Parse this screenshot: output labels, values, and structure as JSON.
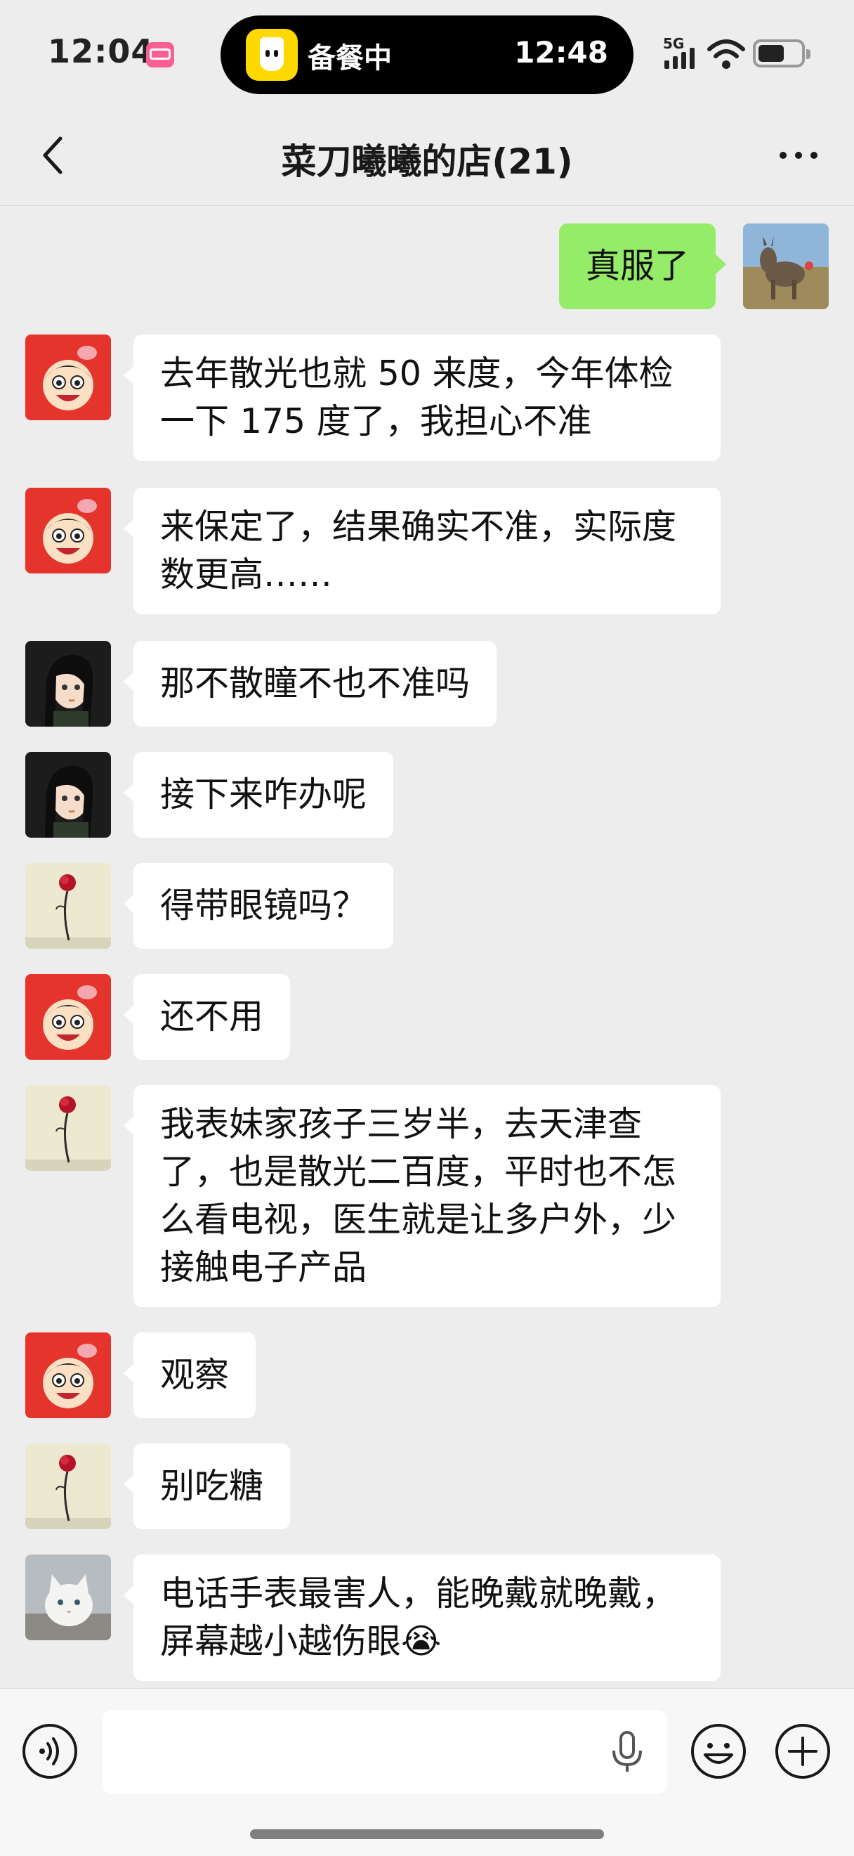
{
  "status_bar": {
    "time": "12:04",
    "network": "5G",
    "island_app": "备餐中",
    "island_timer": "12:48"
  },
  "nav": {
    "title": "菜刀曦曦的店(21)"
  },
  "messages": [
    {
      "sender": "self",
      "avatar": "donkey-avatar",
      "lines": [
        "真服了"
      ]
    },
    {
      "sender": "other",
      "avatar": "cartoon-boy-avatar",
      "lines": [
        "去年散光也就 50 来度，今年体检",
        "一下 175 度了，我担心不准"
      ]
    },
    {
      "sender": "other",
      "avatar": "cartoon-boy-avatar",
      "lines": [
        "来保定了，结果确实不准，实际度",
        "数更高……"
      ]
    },
    {
      "sender": "other",
      "avatar": "anime-girl-avatar",
      "lines": [
        "那不散瞳不也不准吗"
      ]
    },
    {
      "sender": "other",
      "avatar": "anime-girl-avatar",
      "lines": [
        "接下来咋办呢"
      ]
    },
    {
      "sender": "other",
      "avatar": "rose-avatar",
      "lines": [
        "得带眼镜吗？"
      ]
    },
    {
      "sender": "other",
      "avatar": "cartoon-boy-avatar",
      "lines": [
        "还不用"
      ]
    },
    {
      "sender": "other",
      "avatar": "rose-avatar",
      "lines": [
        "我表妹家孩子三岁半，去天津查",
        "了，也是散光二百度，平时也不怎",
        "么看电视，医生就是让多户外，少",
        "接触电子产品"
      ]
    },
    {
      "sender": "other",
      "avatar": "cartoon-boy-avatar",
      "lines": [
        "观察"
      ]
    },
    {
      "sender": "other",
      "avatar": "rose-avatar",
      "lines": [
        "别吃糖"
      ]
    },
    {
      "sender": "other",
      "avatar": "cat-avatar",
      "lines": [
        "电话手表最害人，能晚戴就晚戴，",
        "屏幕越小越伤眼😭"
      ]
    }
  ],
  "input_bar": {
    "placeholder": ""
  },
  "icons": {
    "back": "back-arrow-icon",
    "more": "more-icon",
    "voice": "voice-icon",
    "mic": "microphone-icon",
    "emoji": "emoji-icon",
    "plus": "plus-icon"
  },
  "colors": {
    "background": "#ededed",
    "self_bubble": "#95ec69",
    "other_bubble": "#ffffff"
  }
}
